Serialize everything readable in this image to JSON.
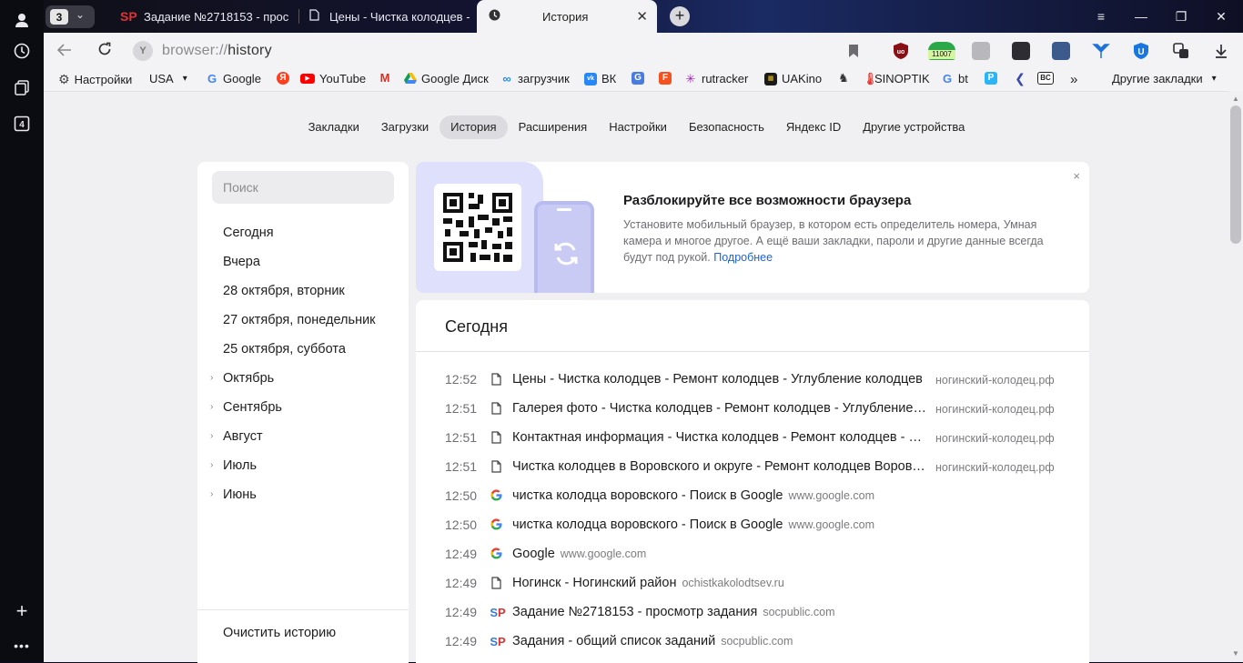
{
  "window": {
    "tab_count": "3",
    "tabs": [
      {
        "favicon": "SP",
        "title": "Задание №2718153 - прос"
      },
      {
        "favicon": "page",
        "title": "Цены - Чистка колодцев -"
      },
      {
        "favicon": "clock",
        "title": "История"
      }
    ],
    "new_tab": "+",
    "controls": {
      "menu": "≡",
      "minimize": "—",
      "restore": "❐",
      "close": "✕"
    }
  },
  "address": {
    "scheme": "browser://",
    "path": "history"
  },
  "extensions": [
    {
      "icon": "bookmark-icon",
      "color": "#6b6b70"
    },
    {
      "icon": "ublock-icon",
      "color": "#8a0f14"
    },
    {
      "icon": "counter-icon",
      "color": "#2aa84a",
      "label": "11007"
    },
    {
      "icon": "suitcase-icon",
      "color": "#7a7a80"
    },
    {
      "icon": "arrow-icon",
      "color": "#2d2d33"
    },
    {
      "icon": "transfer-icon",
      "color": "#3d5a8c"
    },
    {
      "icon": "drop-icon",
      "color": "#1f73d8"
    },
    {
      "icon": "shield-u-icon",
      "color": "#1976e0"
    },
    {
      "icon": "translate-icon",
      "color": "#2d2d33"
    },
    {
      "icon": "download-icon",
      "color": "#2d2d33"
    }
  ],
  "bookmarks": {
    "items": [
      {
        "label": "Настройки",
        "icon": "gear-icon",
        "color": "#444"
      },
      {
        "label": "USA",
        "icon": "",
        "color": ""
      },
      {
        "label": "Google",
        "icon": "google-icon",
        "color": "#4285f4"
      },
      {
        "label": "",
        "icon": "yandex-icon",
        "color": "#fc3f1d"
      },
      {
        "label": "YouTube",
        "icon": "youtube-icon",
        "color": "#ff0000"
      },
      {
        "label": "",
        "icon": "gmail-icon",
        "color": "#d93025"
      },
      {
        "label": "Google Диск",
        "icon": "drive-icon",
        "color": "#0f9d58"
      },
      {
        "label": "загрузчик",
        "icon": "loop-icon",
        "color": "#1e88e5"
      },
      {
        "label": "ВК",
        "icon": "vk-icon",
        "color": "#2787f5"
      },
      {
        "label": "",
        "icon": "translate-g-icon",
        "color": "#4a7be0"
      },
      {
        "label": "",
        "icon": "f-icon",
        "color": "#f4511e"
      },
      {
        "label": "rutracker",
        "icon": "rutracker-icon",
        "color": "#9c27b0"
      },
      {
        "label": "UAKino",
        "icon": "uakino-icon",
        "color": "#1b1b1b"
      },
      {
        "label": "",
        "icon": "chess-icon",
        "color": "#333"
      },
      {
        "label": "SINOPTIK",
        "icon": "thermometer-icon",
        "color": "#e53935"
      },
      {
        "label": "bt",
        "icon": "google-icon",
        "color": "#4285f4"
      },
      {
        "label": "",
        "icon": "p-icon",
        "color": "#29b6f6"
      },
      {
        "label": "",
        "icon": "chevron-left-icon",
        "color": "#3949ab"
      },
      {
        "label": "",
        "icon": "bc-icon",
        "color": "#222"
      }
    ],
    "more": "»",
    "other": "Другие закладки"
  },
  "topnav": {
    "items": [
      "Закладки",
      "Загрузки",
      "История",
      "Расширения",
      "Настройки",
      "Безопасность",
      "Яндекс ID",
      "Другие устройства"
    ],
    "active": "История"
  },
  "sidebar": {
    "search_placeholder": "Поиск",
    "items": [
      {
        "label": "Сегодня",
        "expandable": false
      },
      {
        "label": "Вчера",
        "expandable": false
      },
      {
        "label": "28 октября, вторник",
        "expandable": false
      },
      {
        "label": "27 октября, понедельник",
        "expandable": false
      },
      {
        "label": "25 октября, суббота",
        "expandable": false
      },
      {
        "label": "Октябрь",
        "expandable": true
      },
      {
        "label": "Сентябрь",
        "expandable": true
      },
      {
        "label": "Август",
        "expandable": true
      },
      {
        "label": "Июль",
        "expandable": true
      },
      {
        "label": "Июнь",
        "expandable": true
      }
    ],
    "clear": "Очистить историю"
  },
  "promo": {
    "title": "Разблокируйте все возможности браузера",
    "description": "Установите мобильный браузер, в котором есть определитель номера, Умная камера и многое другое. А ещё ваши закладки, пароли и другие данные всегда будут под рукой.",
    "link": "Подробнее",
    "close": "×"
  },
  "history": {
    "heading": "Сегодня",
    "entries": [
      {
        "time": "12:52",
        "favicon": "page",
        "title": "Цены - Чистка колодцев - Ремонт колодцев - Углубление колодцев",
        "domain": "ногинский-колодец.рф",
        "truncated": true
      },
      {
        "time": "12:51",
        "favicon": "page",
        "title": "Галерея фото - Чистка колодцев - Ремонт колодцев - Углубление колодцев",
        "domain": "ногинский-колодец.рф",
        "truncated": true
      },
      {
        "time": "12:51",
        "favicon": "page",
        "title": "Контактная информация - Чистка колодцев - Ремонт колодцев - Углубление",
        "domain": "ногинский-колодец.рф",
        "truncated": true
      },
      {
        "time": "12:51",
        "favicon": "page",
        "title": "Чистка колодцев в Воровского и округе - Ремонт колодцев Воровского",
        "domain": "ногинский-колодец.рф",
        "truncated": true
      },
      {
        "time": "12:50",
        "favicon": "google",
        "title": "чистка колодца воровского - Поиск в Google",
        "domain": "www.google.com",
        "truncated": false
      },
      {
        "time": "12:50",
        "favicon": "google",
        "title": "чистка колодца воровского - Поиск в Google",
        "domain": "www.google.com",
        "truncated": false
      },
      {
        "time": "12:49",
        "favicon": "google",
        "title": "Google",
        "domain": "www.google.com",
        "truncated": false
      },
      {
        "time": "12:49",
        "favicon": "page",
        "title": "Ногинск - Ногинский район",
        "domain": "ochistkakolodtsev.ru",
        "truncated": false
      },
      {
        "time": "12:49",
        "favicon": "SP",
        "title": "Задание №2718153 - просмотр задания",
        "domain": "socpublic.com",
        "truncated": false
      },
      {
        "time": "12:49",
        "favicon": "SP",
        "title": "Задания - общий список заданий",
        "domain": "socpublic.com",
        "truncated": false
      }
    ]
  }
}
